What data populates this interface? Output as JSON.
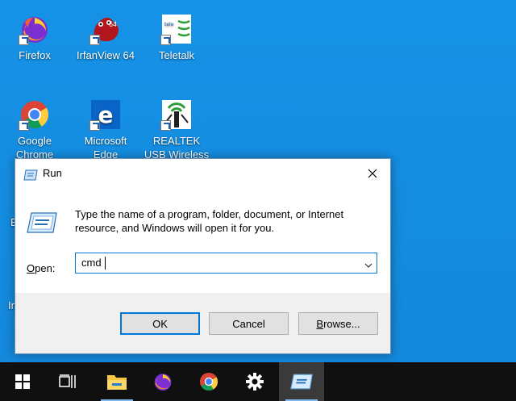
{
  "desktop": {
    "icons": [
      {
        "label": "Firefox",
        "icon": "firefox-icon"
      },
      {
        "label": "IrfanView 64",
        "icon": "irfanview-icon"
      },
      {
        "label": "Teletalk",
        "icon": "teletalk-icon"
      },
      {
        "label": "Google Chrome",
        "icon": "chrome-icon"
      },
      {
        "label": "Microsoft Edge",
        "icon": "edge-icon"
      },
      {
        "label": "REALTEK USB Wireless LA...",
        "icon": "realtek-icon"
      }
    ],
    "irfanview_badge": "64",
    "partial_labels": [
      "E",
      "In"
    ]
  },
  "run_dialog": {
    "title": "Run",
    "description": "Type the name of a program, folder, document, or Internet resource, and Windows will open it for you.",
    "open_label_prefix": "",
    "open_label_underlined": "O",
    "open_label_rest": "pen:",
    "open_value": "cmd",
    "buttons": {
      "ok": "OK",
      "cancel": "Cancel",
      "browse_underlined": "B",
      "browse_rest": "rowse..."
    }
  },
  "taskbar": {
    "items": [
      "start-icon",
      "task-view-icon",
      "file-explorer-icon",
      "firefox-icon",
      "chrome-icon",
      "settings-icon",
      "run-icon"
    ]
  },
  "colors": {
    "desktop": "#1592e6",
    "accent": "#0078d7",
    "taskbar": "#101010"
  }
}
